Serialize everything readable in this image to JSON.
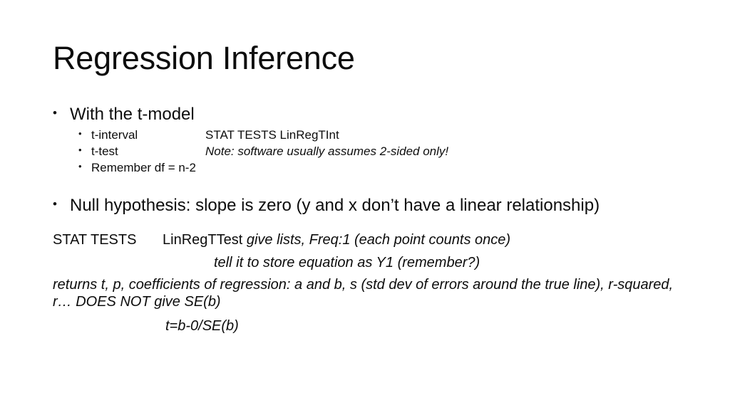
{
  "slide": {
    "title": "Regression Inference",
    "bullets": {
      "level1_a": "With the t-model",
      "sub": [
        {
          "label": "t-interval",
          "detail": "STAT TESTS   LinRegTInt",
          "detail_italic": false
        },
        {
          "label": "t-test",
          "detail": "Note: software usually assumes 2-sided only!",
          "detail_italic": true
        },
        {
          "label": "Remember df = n-2",
          "detail": "",
          "detail_italic": false
        }
      ],
      "level1_b": "Null hypothesis: slope is zero (y and x don’t have a linear relationship)"
    },
    "paragraphs": {
      "stat_tests_label": "STAT TESTS",
      "linregttest_label": "LinRegTTest",
      "linregttest_note": "give lists, Freq:1 (each point counts once)",
      "store_equation": "tell it to store equation as Y1 (remember?)",
      "returns_line": "returns t, p, coefficients of regression: a and b, s (std dev of errors around the true line), r-squared, r…   DOES NOT give SE(b)",
      "formula": "t=b-0/SE(b)"
    },
    "glyphs": {
      "bullet": "•"
    }
  }
}
